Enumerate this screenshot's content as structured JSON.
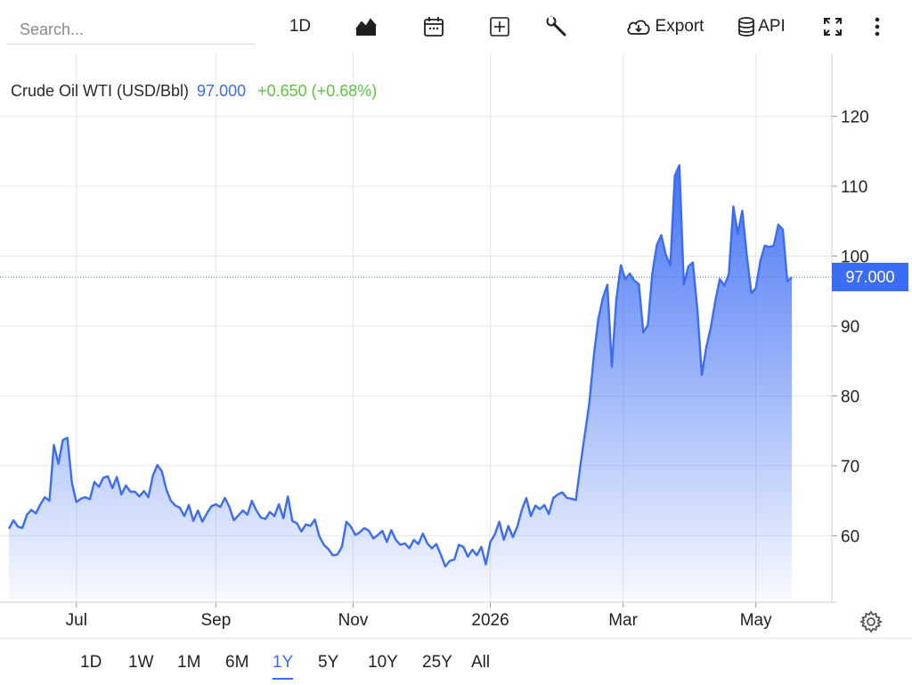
{
  "toolbar": {
    "search_placeholder": "Search...",
    "interval_label": "1D",
    "export_label": "Export",
    "api_label": "API"
  },
  "legend": {
    "name": "Crude Oil WTI (USD/Bbl)",
    "price": "97.000",
    "change": "+0.650 (+0.68%)"
  },
  "price_tag": "97.000",
  "colors": {
    "line": "#3b6cf4",
    "positive": "#5cc341",
    "grid": "#e6e6e6"
  },
  "ranges": [
    "1D",
    "1W",
    "1M",
    "6M",
    "1Y",
    "5Y",
    "10Y",
    "25Y",
    "All"
  ],
  "active_range": "1Y",
  "chart_data": {
    "type": "area",
    "title": "Crude Oil WTI (USD/Bbl)",
    "ylim": [
      51,
      129
    ],
    "yticks": [
      120,
      110,
      100,
      90,
      80,
      70,
      60
    ],
    "x_labels": [
      "Jul",
      "Sep",
      "Nov",
      "2026",
      "Mar",
      "May"
    ],
    "x_label_days": [
      30,
      92,
      153,
      214,
      273,
      332
    ],
    "last_value": 97.0,
    "series": [
      {
        "values": [
          [
            0,
            61.0
          ],
          [
            2,
            62.2
          ],
          [
            4,
            61.3
          ],
          [
            6,
            61.1
          ],
          [
            8,
            63.0
          ],
          [
            10,
            63.7
          ],
          [
            12,
            63.2
          ],
          [
            14,
            64.5
          ],
          [
            16,
            65.5
          ],
          [
            18,
            65.0
          ],
          [
            20,
            73.0
          ],
          [
            22,
            70.3
          ],
          [
            24,
            73.7
          ],
          [
            26,
            74.0
          ],
          [
            28,
            67.6
          ],
          [
            30,
            64.8
          ],
          [
            32,
            65.3
          ],
          [
            34,
            65.5
          ],
          [
            36,
            65.2
          ],
          [
            38,
            67.7
          ],
          [
            40,
            67.0
          ],
          [
            42,
            68.3
          ],
          [
            44,
            68.5
          ],
          [
            46,
            66.8
          ],
          [
            48,
            68.4
          ],
          [
            50,
            65.9
          ],
          [
            52,
            67.2
          ],
          [
            54,
            66.3
          ],
          [
            56,
            66.3
          ],
          [
            58,
            65.6
          ],
          [
            60,
            66.4
          ],
          [
            62,
            65.5
          ],
          [
            64,
            68.6
          ],
          [
            66,
            70.1
          ],
          [
            68,
            69.2
          ],
          [
            70,
            66.6
          ],
          [
            72,
            65.0
          ],
          [
            74,
            64.3
          ],
          [
            76,
            64.0
          ],
          [
            78,
            62.8
          ],
          [
            80,
            64.4
          ],
          [
            82,
            62.1
          ],
          [
            84,
            63.6
          ],
          [
            86,
            62.0
          ],
          [
            88,
            63.2
          ],
          [
            90,
            64.2
          ],
          [
            92,
            64.5
          ],
          [
            94,
            64.1
          ],
          [
            96,
            65.4
          ],
          [
            98,
            64.1
          ],
          [
            100,
            62.2
          ],
          [
            102,
            62.9
          ],
          [
            104,
            63.6
          ],
          [
            106,
            63.0
          ],
          [
            108,
            65.0
          ],
          [
            110,
            63.6
          ],
          [
            112,
            62.6
          ],
          [
            114,
            62.4
          ],
          [
            116,
            63.4
          ],
          [
            118,
            62.8
          ],
          [
            120,
            64.5
          ],
          [
            122,
            62.5
          ],
          [
            124,
            65.6
          ],
          [
            126,
            62.1
          ],
          [
            128,
            61.8
          ],
          [
            130,
            60.6
          ],
          [
            132,
            61.6
          ],
          [
            134,
            61.4
          ],
          [
            136,
            62.3
          ],
          [
            138,
            59.9
          ],
          [
            140,
            58.7
          ],
          [
            142,
            58.1
          ],
          [
            144,
            57.2
          ],
          [
            146,
            57.3
          ],
          [
            148,
            58.4
          ],
          [
            150,
            62.0
          ],
          [
            152,
            61.3
          ],
          [
            154,
            60.1
          ],
          [
            156,
            60.5
          ],
          [
            158,
            61.1
          ],
          [
            160,
            60.7
          ],
          [
            162,
            59.6
          ],
          [
            164,
            60.1
          ],
          [
            166,
            60.7
          ],
          [
            168,
            59.1
          ],
          [
            170,
            60.8
          ],
          [
            172,
            59.4
          ],
          [
            174,
            58.7
          ],
          [
            176,
            58.9
          ],
          [
            178,
            58.2
          ],
          [
            180,
            59.4
          ],
          [
            182,
            58.8
          ],
          [
            184,
            60.3
          ],
          [
            186,
            58.9
          ],
          [
            188,
            58.2
          ],
          [
            190,
            58.8
          ],
          [
            192,
            57.3
          ],
          [
            194,
            55.6
          ],
          [
            196,
            56.4
          ],
          [
            198,
            56.6
          ],
          [
            200,
            58.7
          ],
          [
            202,
            58.4
          ],
          [
            204,
            57.0
          ],
          [
            206,
            58.0
          ],
          [
            208,
            57.2
          ],
          [
            210,
            58.4
          ],
          [
            212,
            55.9
          ],
          [
            214,
            59.1
          ],
          [
            216,
            60.2
          ],
          [
            218,
            62.0
          ],
          [
            220,
            59.4
          ],
          [
            222,
            61.4
          ],
          [
            224,
            59.8
          ],
          [
            226,
            61.3
          ],
          [
            228,
            63.7
          ],
          [
            230,
            65.4
          ],
          [
            232,
            62.8
          ],
          [
            234,
            64.3
          ],
          [
            236,
            63.8
          ],
          [
            238,
            64.4
          ],
          [
            240,
            63.1
          ],
          [
            242,
            65.4
          ],
          [
            244,
            65.9
          ],
          [
            246,
            66.2
          ],
          [
            248,
            65.4
          ],
          [
            250,
            65.3
          ],
          [
            252,
            65.1
          ],
          [
            254,
            70.0
          ],
          [
            256,
            74.5
          ],
          [
            258,
            79.0
          ],
          [
            260,
            85.8
          ],
          [
            262,
            91.0
          ],
          [
            264,
            94.0
          ],
          [
            266,
            95.9
          ],
          [
            268,
            84.2
          ],
          [
            270,
            93.8
          ],
          [
            272,
            98.7
          ],
          [
            274,
            96.7
          ],
          [
            276,
            97.5
          ],
          [
            278,
            96.5
          ],
          [
            280,
            96.0
          ],
          [
            282,
            89.1
          ],
          [
            284,
            90.1
          ],
          [
            286,
            97.5
          ],
          [
            288,
            101.6
          ],
          [
            290,
            103.0
          ],
          [
            292,
            100.2
          ],
          [
            294,
            98.7
          ],
          [
            296,
            111.5
          ],
          [
            298,
            113.0
          ],
          [
            300,
            95.9
          ],
          [
            302,
            98.5
          ],
          [
            304,
            99.1
          ],
          [
            306,
            92.4
          ],
          [
            308,
            83.0
          ],
          [
            310,
            87.0
          ],
          [
            312,
            89.8
          ],
          [
            314,
            93.6
          ],
          [
            316,
            96.7
          ],
          [
            318,
            95.8
          ],
          [
            320,
            97.4
          ],
          [
            322,
            107.1
          ],
          [
            324,
            103.2
          ],
          [
            326,
            106.5
          ],
          [
            328,
            100.1
          ],
          [
            330,
            94.7
          ],
          [
            332,
            95.4
          ],
          [
            334,
            99.3
          ],
          [
            336,
            101.5
          ],
          [
            338,
            101.3
          ],
          [
            340,
            101.5
          ],
          [
            342,
            104.5
          ],
          [
            344,
            103.8
          ],
          [
            346,
            96.4
          ],
          [
            348,
            97.0
          ]
        ]
      }
    ]
  }
}
